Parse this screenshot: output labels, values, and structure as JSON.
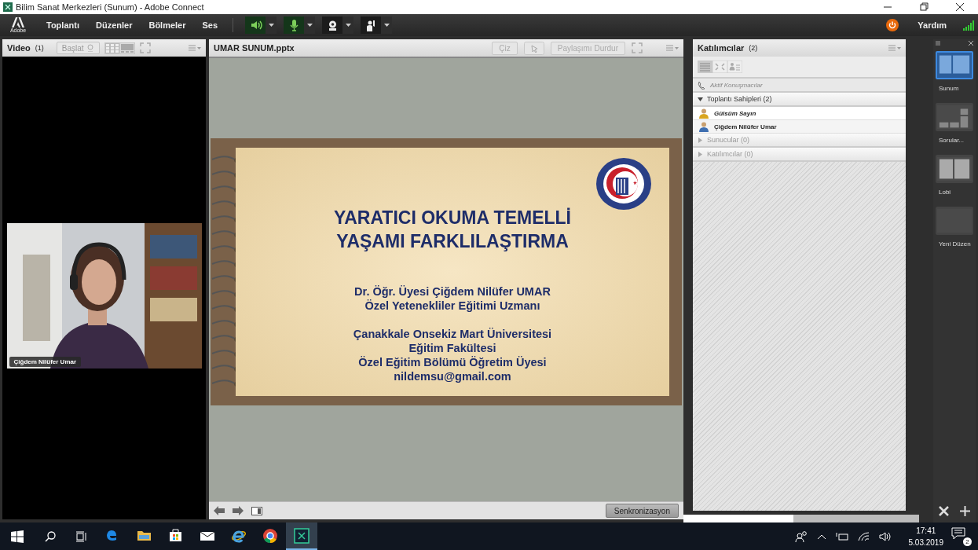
{
  "window": {
    "title": "Bilim Sanat Merkezleri (Sunum) - Adobe Connect"
  },
  "menu_bar": {
    "logo_text": "Adobe",
    "items": [
      "Toplantı",
      "Düzenler",
      "Bölmeler",
      "Ses"
    ],
    "help": "Yardım",
    "controls": [
      {
        "kind": "speaker",
        "on": true
      },
      {
        "kind": "microphone",
        "on": true
      },
      {
        "kind": "camera",
        "on": false
      },
      {
        "kind": "hand",
        "on": false
      }
    ]
  },
  "video_pod": {
    "title": "Video",
    "count": "(1)",
    "start_button": "Başlat",
    "participant_label": "Çiğdem Nilüfer Umar"
  },
  "share_pod": {
    "title": "UMAR SUNUM.pptx",
    "draw_button": "Çiz",
    "stop_button": "Paylaşımı Durdur",
    "sync_button": "Senkronizasyon",
    "slide": {
      "title_lines": [
        "YARATICI OKUMA TEMELLİ",
        "YAŞAMI FARKLILAŞTIRMA"
      ],
      "author_lines": [
        "Dr. Öğr. Üyesi Çiğdem Nilüfer UMAR",
        "Özel Yetenekliler Eğitimi Uzmanı"
      ],
      "affiliation_lines": [
        "Çanakkale Onsekiz Mart Üniversitesi",
        "Eğitim Fakültesi",
        "Özel Eğitim Bölümü Öğretim Üyesi",
        "nildemsu@gmail.com"
      ]
    }
  },
  "attendees_pod": {
    "title": "Katılımcılar",
    "count": "(2)",
    "active_speakers": "Aktif Konuşmacılar",
    "groups": [
      {
        "label": "Toplantı Sahipleri (2)",
        "expanded": true,
        "children": [
          {
            "name": "Gülsüm Sayın",
            "color": "#d9a520"
          },
          {
            "name": "Çiğdem Nilüfer Umar",
            "color": "#3f6fb0"
          }
        ]
      },
      {
        "label": "Sunucular (0)",
        "expanded": false
      },
      {
        "label": "Katılımcılar (0)",
        "expanded": false
      }
    ]
  },
  "layouts": [
    {
      "label": "Sunum",
      "kind": "split",
      "selected": true
    },
    {
      "label": "Sorular...",
      "kind": "qa",
      "selected": false
    },
    {
      "label": "Lobi",
      "kind": "halves",
      "selected": false
    },
    {
      "label": "Yeni Düzen",
      "kind": "blank",
      "selected": false
    }
  ],
  "taskbar": {
    "apps": [
      {
        "kind": "edge",
        "selected": false
      },
      {
        "kind": "folder",
        "selected": false
      },
      {
        "kind": "store",
        "selected": false
      },
      {
        "kind": "mail",
        "selected": false
      },
      {
        "kind": "ie",
        "selected": false
      },
      {
        "kind": "chrome",
        "selected": false
      },
      {
        "kind": "connect",
        "selected": true
      }
    ],
    "time": "17:41",
    "date": "5.03.2019",
    "notifications": "2"
  }
}
